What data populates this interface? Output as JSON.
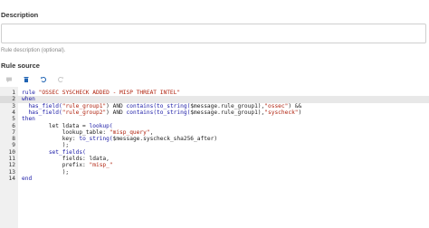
{
  "description": {
    "title": "Description",
    "value": "",
    "help_text": "Rule description (optional)."
  },
  "rule_source": {
    "title": "Rule source",
    "toolbar": [
      {
        "name": "comment-icon",
        "enabled": false
      },
      {
        "name": "delete-icon",
        "enabled": true
      },
      {
        "name": "undo-icon",
        "enabled": true
      },
      {
        "name": "redo-icon",
        "enabled": false
      }
    ]
  },
  "editor": {
    "active_line": 2,
    "lines": [
      {
        "n": "1",
        "parts": [
          [
            "kw",
            "rule "
          ],
          [
            "str",
            "\"OSSEC SYSCHECK ADDED - MISP THREAT INTEL\""
          ]
        ]
      },
      {
        "n": "2",
        "parts": [
          [
            "kw",
            "when"
          ]
        ]
      },
      {
        "n": "3",
        "parts": [
          [
            "pl",
            "  "
          ],
          [
            "fn",
            "has_field("
          ],
          [
            "str",
            "\"rule_group1\""
          ],
          [
            "pl",
            ") AND "
          ],
          [
            "fn",
            "contains(to_string("
          ],
          [
            "pl",
            "$message.rule_group1),"
          ],
          [
            "str",
            "\"ossec\""
          ],
          [
            "pl",
            ") &&"
          ]
        ]
      },
      {
        "n": "4",
        "parts": [
          [
            "pl",
            "  "
          ],
          [
            "fn",
            "has_field("
          ],
          [
            "str",
            "\"rule_group2\""
          ],
          [
            "pl",
            ") AND "
          ],
          [
            "fn",
            "contains(to_string("
          ],
          [
            "pl",
            "$message.rule_group1),"
          ],
          [
            "str",
            "\"syscheck\""
          ],
          [
            "pl",
            ")"
          ]
        ]
      },
      {
        "n": "5",
        "parts": [
          [
            "kw",
            "then"
          ]
        ]
      },
      {
        "n": "6",
        "parts": [
          [
            "pl",
            "        let ldata = "
          ],
          [
            "fn",
            "lookup("
          ]
        ]
      },
      {
        "n": "7",
        "parts": [
          [
            "pl",
            "            lookup_table: "
          ],
          [
            "str",
            "\"misp_query\""
          ],
          [
            "pl",
            ","
          ]
        ]
      },
      {
        "n": "8",
        "parts": [
          [
            "pl",
            "            key: "
          ],
          [
            "fn",
            "to_string("
          ],
          [
            "pl",
            "$message.syscheck_sha256_after)"
          ]
        ]
      },
      {
        "n": "9",
        "parts": [
          [
            "pl",
            "            );"
          ]
        ]
      },
      {
        "n": "10",
        "parts": [
          [
            "pl",
            "        "
          ],
          [
            "fn",
            "set_fields("
          ]
        ]
      },
      {
        "n": "11",
        "parts": [
          [
            "pl",
            "            fields: ldata,"
          ]
        ]
      },
      {
        "n": "12",
        "parts": [
          [
            "pl",
            "            prefix: "
          ],
          [
            "str",
            "\"misp_\""
          ]
        ]
      },
      {
        "n": "13",
        "parts": [
          [
            "pl",
            "            );"
          ]
        ]
      },
      {
        "n": "14",
        "parts": [
          [
            "kw",
            "end"
          ]
        ]
      }
    ]
  }
}
